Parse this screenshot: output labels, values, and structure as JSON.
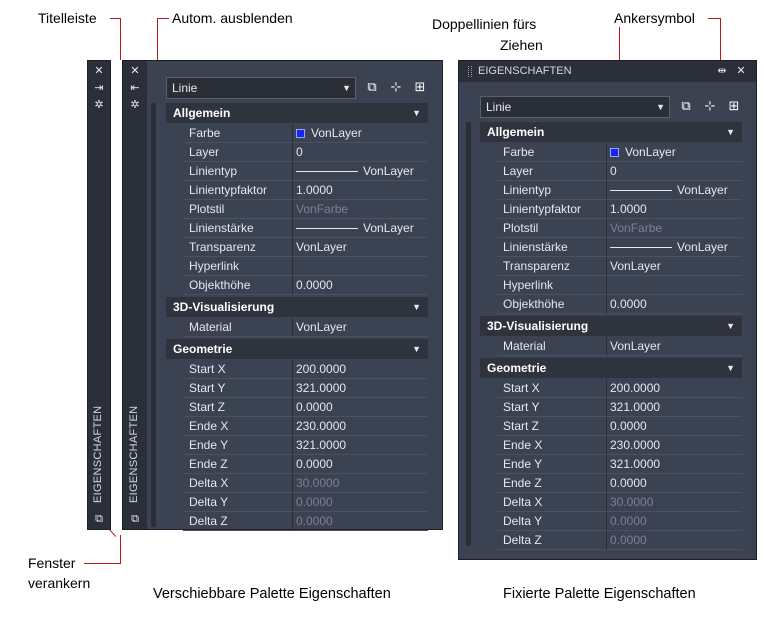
{
  "annotations": {
    "titelleiste": "Titelleiste",
    "autom_ausblenden": "Autom. ausblenden",
    "doppellinien_1": "Doppellinien fürs",
    "doppellinien_2": "Ziehen",
    "ankersymbol": "Ankersymbol",
    "fenster_1": "Fenster",
    "fenster_2": "verankern"
  },
  "captions": {
    "floating": "Verschiebbare Palette Eigenschaften",
    "docked": "Fixierte Palette Eigenschaften"
  },
  "palette_title": "EIGENSCHAFTEN",
  "object_select": "Linie",
  "icons": {
    "close": "close-icon",
    "autohide": "autohide-icon",
    "properties": "properties-settings-icon",
    "anchor": "anchor-icon",
    "dock": "dock-window-icon",
    "quickselect": "quick-select-icon",
    "selectobjects": "select-objects-icon",
    "pickadd": "toggle-pickadd-icon"
  },
  "colors": {
    "panel_bg": "#3b4252",
    "titlebar_bg": "#2b2f39",
    "header_bg": "#2e333e",
    "swatch_blue": "#1328e8",
    "leader_red": "#c0141c"
  },
  "categories": [
    {
      "title": "Allgemein",
      "rows": [
        {
          "name": "Farbe",
          "value": "VonLayer",
          "kind": "color"
        },
        {
          "name": "Layer",
          "value": "0"
        },
        {
          "name": "Linientyp",
          "value": "VonLayer",
          "kind": "line"
        },
        {
          "name": "Linientypfaktor",
          "value": "1.0000"
        },
        {
          "name": "Plotstil",
          "value": "VonFarbe",
          "dim": true
        },
        {
          "name": "Linienstärke",
          "value": "VonLayer",
          "kind": "line"
        },
        {
          "name": "Transparenz",
          "value": "VonLayer"
        },
        {
          "name": "Hyperlink",
          "value": ""
        },
        {
          "name": "Objekthöhe",
          "value": "0.0000"
        }
      ]
    },
    {
      "title": "3D-Visualisierung",
      "rows": [
        {
          "name": "Material",
          "value": "VonLayer"
        }
      ]
    },
    {
      "title": "Geometrie",
      "rows": [
        {
          "name": "Start X",
          "value": "200.0000"
        },
        {
          "name": "Start Y",
          "value": "321.0000"
        },
        {
          "name": "Start Z",
          "value": "0.0000"
        },
        {
          "name": "Ende X",
          "value": "230.0000"
        },
        {
          "name": "Ende Y",
          "value": "321.0000"
        },
        {
          "name": "Ende Z",
          "value": "0.0000"
        },
        {
          "name": "Delta X",
          "value": "30.0000",
          "dim": true
        },
        {
          "name": "Delta Y",
          "value": "0.0000",
          "dim": true
        },
        {
          "name": "Delta Z",
          "value": "0.0000",
          "dim": true
        }
      ]
    }
  ]
}
